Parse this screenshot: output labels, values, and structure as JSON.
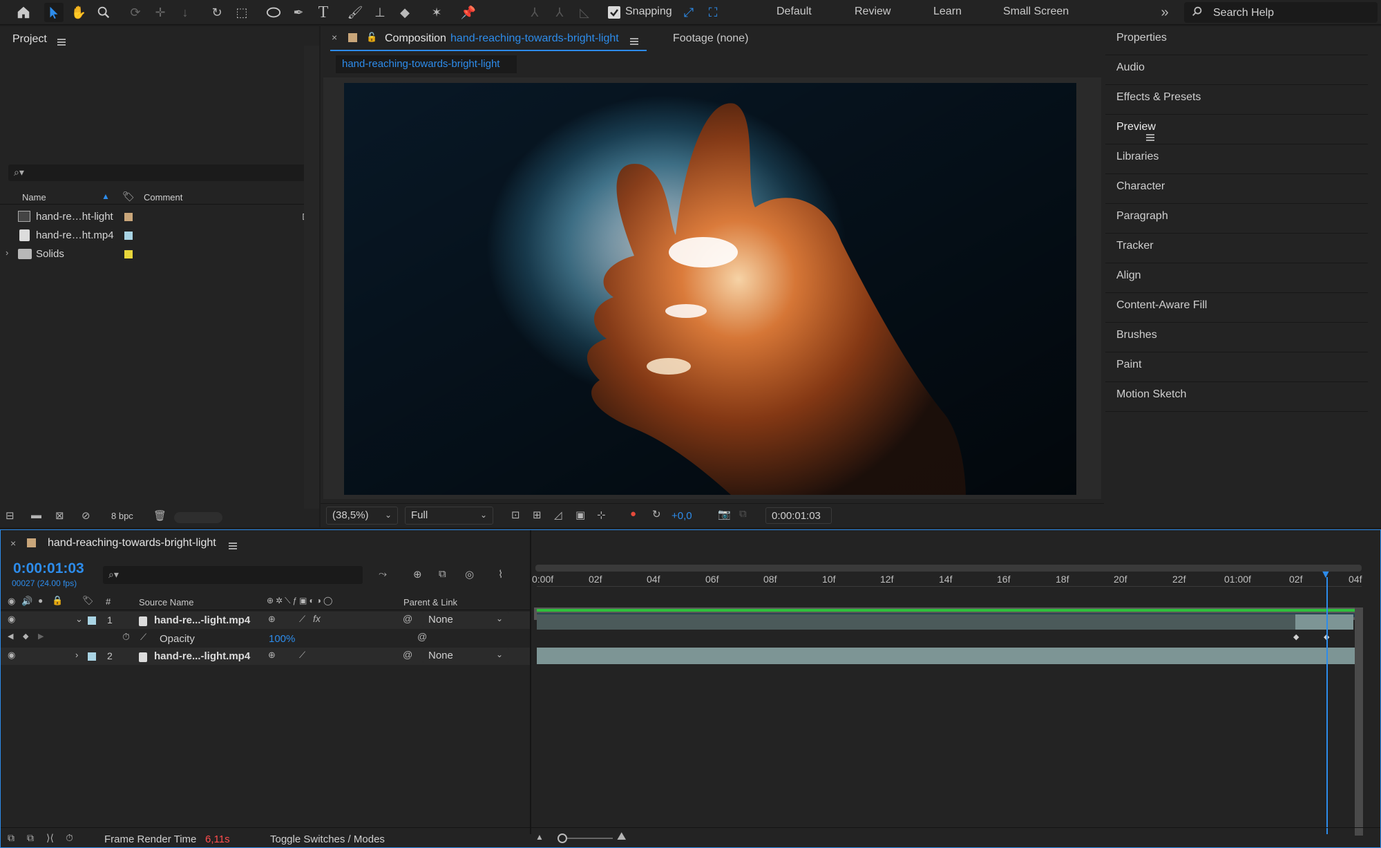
{
  "toolbar": {
    "snapping_label": "Snapping",
    "workspaces": [
      "Default",
      "Review",
      "Learn",
      "Small Screen"
    ],
    "search_placeholder": "Search Help"
  },
  "project": {
    "title": "Project",
    "columns": {
      "name": "Name",
      "comment": "Comment"
    },
    "items": [
      {
        "name": "hand-re…ht-light",
        "color": "#c9a67a"
      },
      {
        "name": "hand-re…ht.mp4",
        "color": "#a9d4e4"
      },
      {
        "name": "Solids",
        "color": "#e8d63b"
      }
    ],
    "bpc": "8 bpc"
  },
  "composition": {
    "tab_prefix": "Composition",
    "tab_name": "hand-reaching-towards-bright-light",
    "footage_tab": "Footage (none)",
    "subtab": "hand-reaching-towards-bright-light",
    "zoom": "(38,5%)",
    "resolution": "Full",
    "exposure": "+0,0",
    "timecode": "0:00:01:03"
  },
  "right_panels": [
    "Properties",
    "Audio",
    "Effects & Presets",
    "Preview",
    "Libraries",
    "Character",
    "Paragraph",
    "Tracker",
    "Align",
    "Content-Aware Fill",
    "Brushes",
    "Paint",
    "Motion Sketch"
  ],
  "timeline": {
    "title": "hand-reaching-towards-bright-light",
    "timecode": "0:00:01:03",
    "frame_info": "00027 (24.00 fps)",
    "col_num": "#",
    "col_source": "Source Name",
    "col_parent": "Parent & Link",
    "ruler": [
      "0:00f",
      "02f",
      "04f",
      "06f",
      "08f",
      "10f",
      "12f",
      "14f",
      "16f",
      "18f",
      "20f",
      "22f",
      "01:00f",
      "02f",
      "04f"
    ],
    "layers": [
      {
        "num": "1",
        "name": "hand-re...-light.mp4",
        "parent": "None",
        "color": "#a9d4e4"
      },
      {
        "num": "2",
        "name": "hand-re...-light.mp4",
        "parent": "None",
        "color": "#a9d4e4"
      }
    ],
    "opacity_label": "Opacity",
    "opacity_value": "100%",
    "frame_render_label": "Frame Render Time",
    "frame_render_value": "6,11s",
    "toggle_label": "Toggle Switches / Modes"
  }
}
